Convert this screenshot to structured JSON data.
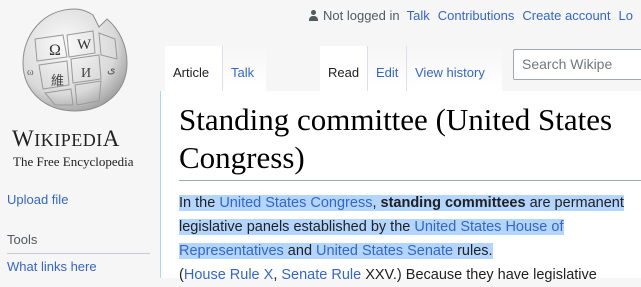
{
  "personal": {
    "not_logged_in": "Not logged in",
    "talk": "Talk",
    "contributions": "Contributions",
    "create_account": "Create account",
    "login": "Lo"
  },
  "logo": {
    "wordmark_first": "W",
    "wordmark_mid": "IKIPEDI",
    "wordmark_last": "A",
    "tagline": "The Free Encyclopedia"
  },
  "sidebar": {
    "upload_file": "Upload file",
    "tools": "Tools",
    "what_links_here": "What links here"
  },
  "tabs": {
    "article": "Article",
    "talk": "Talk",
    "read": "Read",
    "edit": "Edit",
    "view_history": "View history",
    "search_placeholder": "Search Wikipe"
  },
  "article": {
    "title": "Standing committee (United States Congress)",
    "p1_a": "In the ",
    "p1_link1": "United States Congress",
    "p1_b": ", ",
    "p1_bold": "standing committees",
    "p1_c": " are permanent legislative panels established by the ",
    "p1_link2": "United States House of Representatives",
    "p1_d": " and ",
    "p1_link3": "United States Senate",
    "p1_e": " rules.",
    "p2_a": "(",
    "p2_link1": "House Rule X",
    "p2_b": ", ",
    "p2_link2": "Senate Rule",
    "p2_c": " XXV.) Because they have legislative"
  },
  "colors": {
    "link": "#3366cc",
    "highlight": "#b4d5fe"
  },
  "icons": [
    "user-icon",
    "wikipedia-globe-icon"
  ]
}
